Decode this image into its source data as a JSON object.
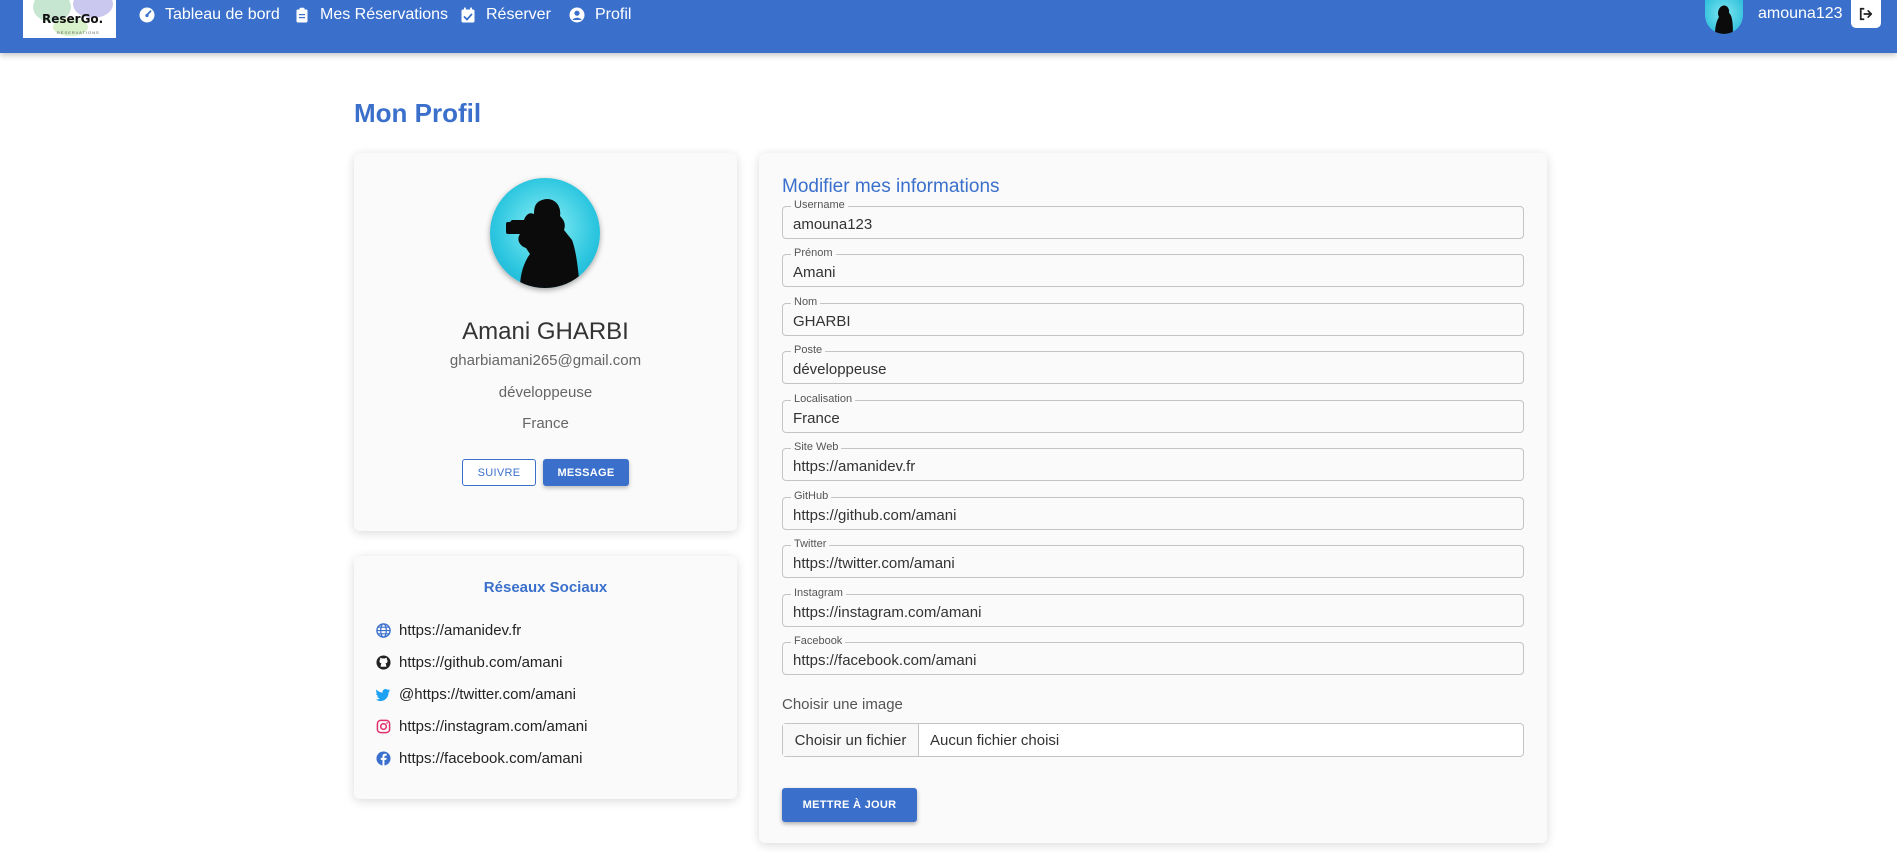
{
  "brand": {
    "logo_text": "ReserGo.",
    "logo_sub": "RÉSERVATIONS"
  },
  "nav": {
    "items": [
      {
        "label": "Tableau de bord",
        "icon": "dashboard-icon"
      },
      {
        "label": "Mes Réservations",
        "icon": "clipboard-icon"
      },
      {
        "label": "Réserver",
        "icon": "calendar-check-icon"
      },
      {
        "label": "Profil",
        "icon": "user-circle-icon"
      }
    ],
    "username": "amouna123"
  },
  "page": {
    "title": "Mon Profil"
  },
  "profile": {
    "name": "Amani GHARBI",
    "email": "gharbiamani265@gmail.com",
    "job": "développeuse",
    "location": "France",
    "follow_label": "SUIVRE",
    "message_label": "MESSAGE"
  },
  "social": {
    "title": "Réseaux Sociaux",
    "items": [
      {
        "icon": "globe-icon",
        "text": "https://amanidev.fr"
      },
      {
        "icon": "github-icon",
        "text": "https://github.com/amani"
      },
      {
        "icon": "twitter-icon",
        "text": "@https://twitter.com/amani"
      },
      {
        "icon": "instagram-icon",
        "text": "https://instagram.com/amani"
      },
      {
        "icon": "facebook-icon",
        "text": "https://facebook.com/amani"
      }
    ]
  },
  "form": {
    "title": "Modifier mes informations",
    "fields": [
      {
        "label": "Username",
        "value": "amouna123"
      },
      {
        "label": "Prénom",
        "value": "Amani"
      },
      {
        "label": "Nom",
        "value": "GHARBI"
      },
      {
        "label": "Poste",
        "value": "développeuse"
      },
      {
        "label": "Localisation",
        "value": "France"
      },
      {
        "label": "Site Web",
        "value": "https://amanidev.fr"
      },
      {
        "label": "GitHub",
        "value": "https://github.com/amani"
      },
      {
        "label": "Twitter",
        "value": "https://twitter.com/amani"
      },
      {
        "label": "Instagram",
        "value": "https://instagram.com/amani"
      },
      {
        "label": "Facebook",
        "value": "https://facebook.com/amani"
      }
    ],
    "image_label": "Choisir une image",
    "file_button": "Choisir un fichier",
    "file_status": "Aucun fichier choisi",
    "submit_label": "METTRE À JOUR"
  },
  "colors": {
    "primary": "#3a70cb",
    "card_bg": "#fafafa",
    "avatar": "#2ec7e0"
  }
}
